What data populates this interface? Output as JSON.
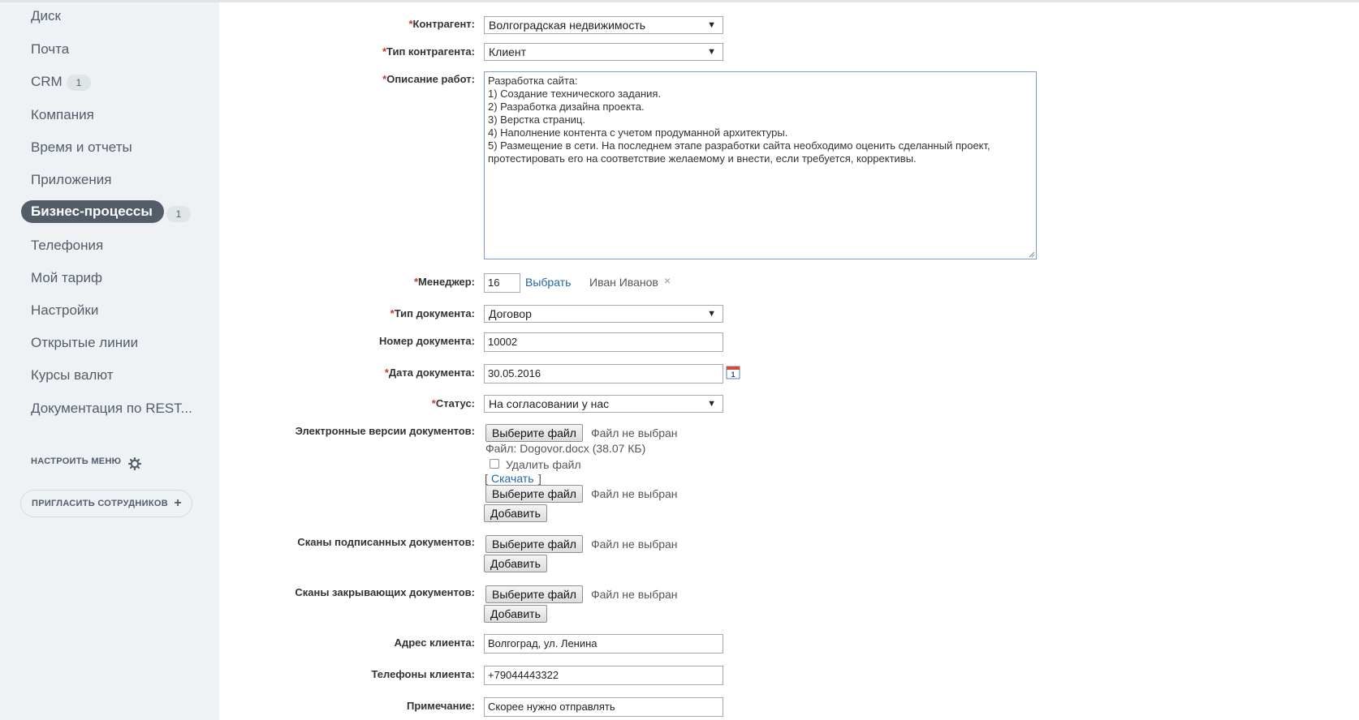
{
  "sidebar": {
    "items": [
      {
        "label": "Диск"
      },
      {
        "label": "Почта"
      },
      {
        "label": "CRM",
        "badge": "1"
      },
      {
        "label": "Компания"
      },
      {
        "label": "Время и отчеты"
      },
      {
        "label": "Приложения"
      },
      {
        "label": "Бизнес-процессы",
        "badge": "1",
        "active": true
      },
      {
        "label": "Телефония"
      },
      {
        "label": "Мой тариф"
      },
      {
        "label": "Настройки"
      },
      {
        "label": "Открытые линии"
      },
      {
        "label": "Курсы валют"
      },
      {
        "label": "Документация по REST..."
      }
    ],
    "configure_menu": "НАСТРОИТЬ МЕНЮ",
    "invite": "ПРИГЛАСИТЬ СОТРУДНИКОВ",
    "gear_icon": "gear-icon",
    "plus_icon": "plus-icon"
  },
  "form": {
    "required_mark": "*",
    "contractor": {
      "label": "Контрагент:",
      "value": "Волгоградская недвижимость"
    },
    "contractor_type": {
      "label": "Тип контрагента:",
      "value": "Клиент"
    },
    "work_description": {
      "label": "Описание работ:",
      "value": "Разработка сайта:\n1) Создание технического задания.\n2) Разработка дизайна проекта.\n3) Верстка страниц.\n4) Наполнение контента с учетом продуманной архитектуры.\n5) Размещение в сети. На последнем этапе разработки сайта необходимо оценить сделанный проект,\nпротестировать его на соответствие желаемому и внести, если требуется, коррективы."
    },
    "manager": {
      "label": "Менеджер:",
      "id": "16",
      "select_link": "Выбрать",
      "name": "Иван Иванов",
      "remove": "×"
    },
    "doc_type": {
      "label": "Тип документа:",
      "value": "Договор"
    },
    "doc_number": {
      "label": "Номер документа:",
      "value": "10002"
    },
    "doc_date": {
      "label": "Дата документа:",
      "value": "30.05.2016",
      "calendar_day": "1"
    },
    "status": {
      "label": "Статус:",
      "value": "На согласовании у нас"
    },
    "electronic_versions": {
      "label": "Электронные версии документов:",
      "choose_file": "Выберите файл",
      "no_file": "Файл не выбран",
      "file_info": "Файл: Dogovor.docx (38.07 КБ)",
      "delete_file": "Удалить файл",
      "download_open": "[",
      "download": "Скачать",
      "download_close": "]",
      "choose_file_2": "Выберите файл",
      "no_file_2": "Файл не выбран",
      "add": "Добавить"
    },
    "signed_scans": {
      "label": "Сканы подписанных документов:",
      "choose_file": "Выберите файл",
      "no_file": "Файл не выбран",
      "add": "Добавить"
    },
    "closing_scans": {
      "label": "Сканы закрывающих документов:",
      "choose_file": "Выберите файл",
      "no_file": "Файл не выбран",
      "add": "Добавить"
    },
    "client_address": {
      "label": "Адрес клиента:",
      "value": "Волгоград, ул. Ленина"
    },
    "client_phones": {
      "label": "Телефоны клиента:",
      "value": "+79044443322"
    },
    "note": {
      "label": "Примечание:",
      "value": "Скорее нужно отправлять"
    }
  },
  "colors": {
    "sidebar_bg": "#eef2f4",
    "active_item_bg": "#535c69",
    "required": "#d0352d",
    "link": "#2067b0",
    "textarea_focus": "#7b9cd6"
  }
}
